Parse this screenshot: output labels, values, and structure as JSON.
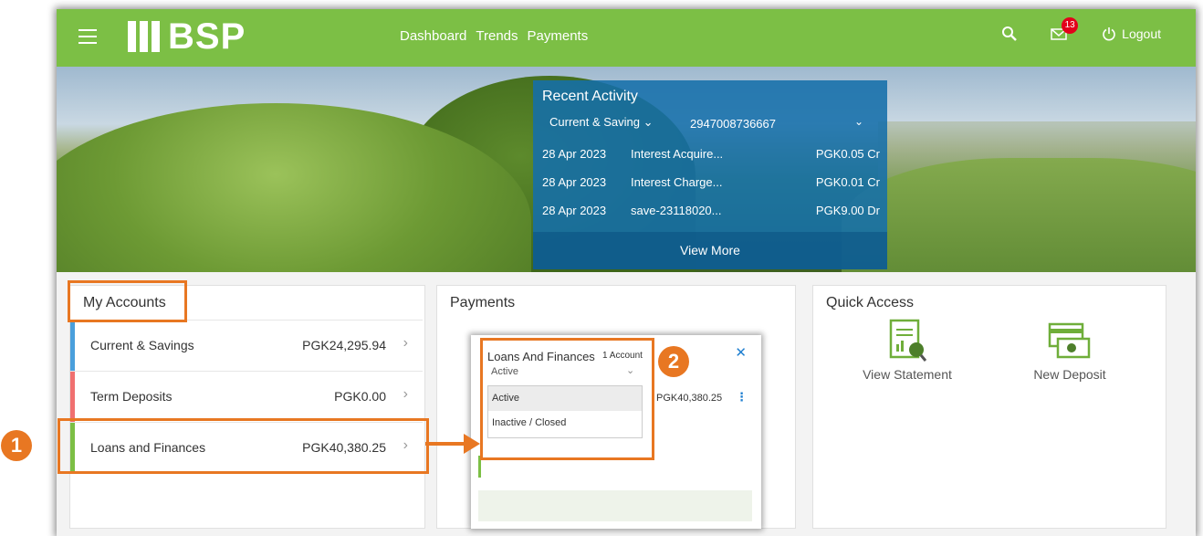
{
  "header": {
    "logo_text": "BSP",
    "nav": [
      "Dashboard",
      "Trends",
      "Payments"
    ],
    "notification_count": "13",
    "logout_label": "Logout"
  },
  "recent_activity": {
    "title": "Recent Activity",
    "account_type": "Current & Saving",
    "account_number": "2947008736667",
    "rows": [
      {
        "date": "28 Apr 2023",
        "desc": "Interest Acquire...",
        "amount": "PGK0.05 Cr"
      },
      {
        "date": "28 Apr 2023",
        "desc": "Interest Charge...",
        "amount": "PGK0.01 Cr"
      },
      {
        "date": "28 Apr 2023",
        "desc": "save-23118020...",
        "amount": "PGK9.00 Dr"
      }
    ],
    "view_more": "View More"
  },
  "my_accounts": {
    "title": "My Accounts",
    "rows": [
      {
        "label": "Current & Savings",
        "amount": "PGK24,295.94",
        "color": "#4a9fdc"
      },
      {
        "label": "Term Deposits",
        "amount": "PGK0.00",
        "color": "#f07070"
      },
      {
        "label": "Loans and Finances",
        "amount": "PGK40,380.25",
        "color": "#7cbf45"
      }
    ]
  },
  "payments": {
    "title": "Payments",
    "popup": {
      "title": "Loans And Finances",
      "count": "1 Account",
      "status": "Active",
      "options": [
        "Active",
        "Inactive / Closed"
      ],
      "amount": "PGK40,380.25"
    }
  },
  "quick_access": {
    "title": "Quick Access",
    "items": [
      "View Statement",
      "New Deposit"
    ]
  },
  "annotations": {
    "step1": "1",
    "step2": "2",
    "color": "#e87722"
  },
  "colors": {
    "brand_green": "#7cbf45",
    "accent_blue": "#1f7fd0"
  }
}
